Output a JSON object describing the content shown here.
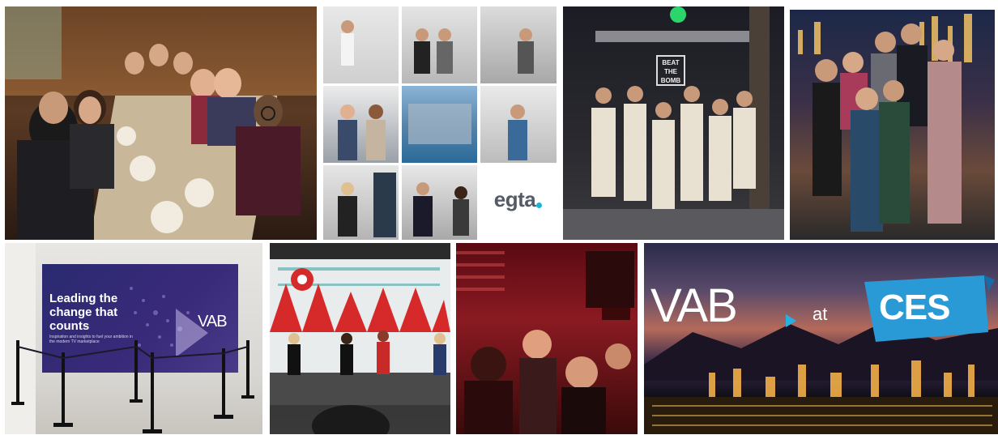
{
  "logos": {
    "egta": "egta",
    "bomb_sign": "BEAT THE BOMB",
    "vab_mark": "VAB",
    "vab_big": "VAB",
    "ces": "CES"
  },
  "banner": {
    "headline": "Leading the change that counts",
    "subtext": "Inspiration and insights to fuel your ambition in the modern TV marketplace"
  },
  "ces_caption": {
    "at": "at"
  },
  "colors": {
    "egta_dot": "#19b5d6",
    "vab_banner": "#2a2a70",
    "ces_badge": "#2a9ad6"
  }
}
